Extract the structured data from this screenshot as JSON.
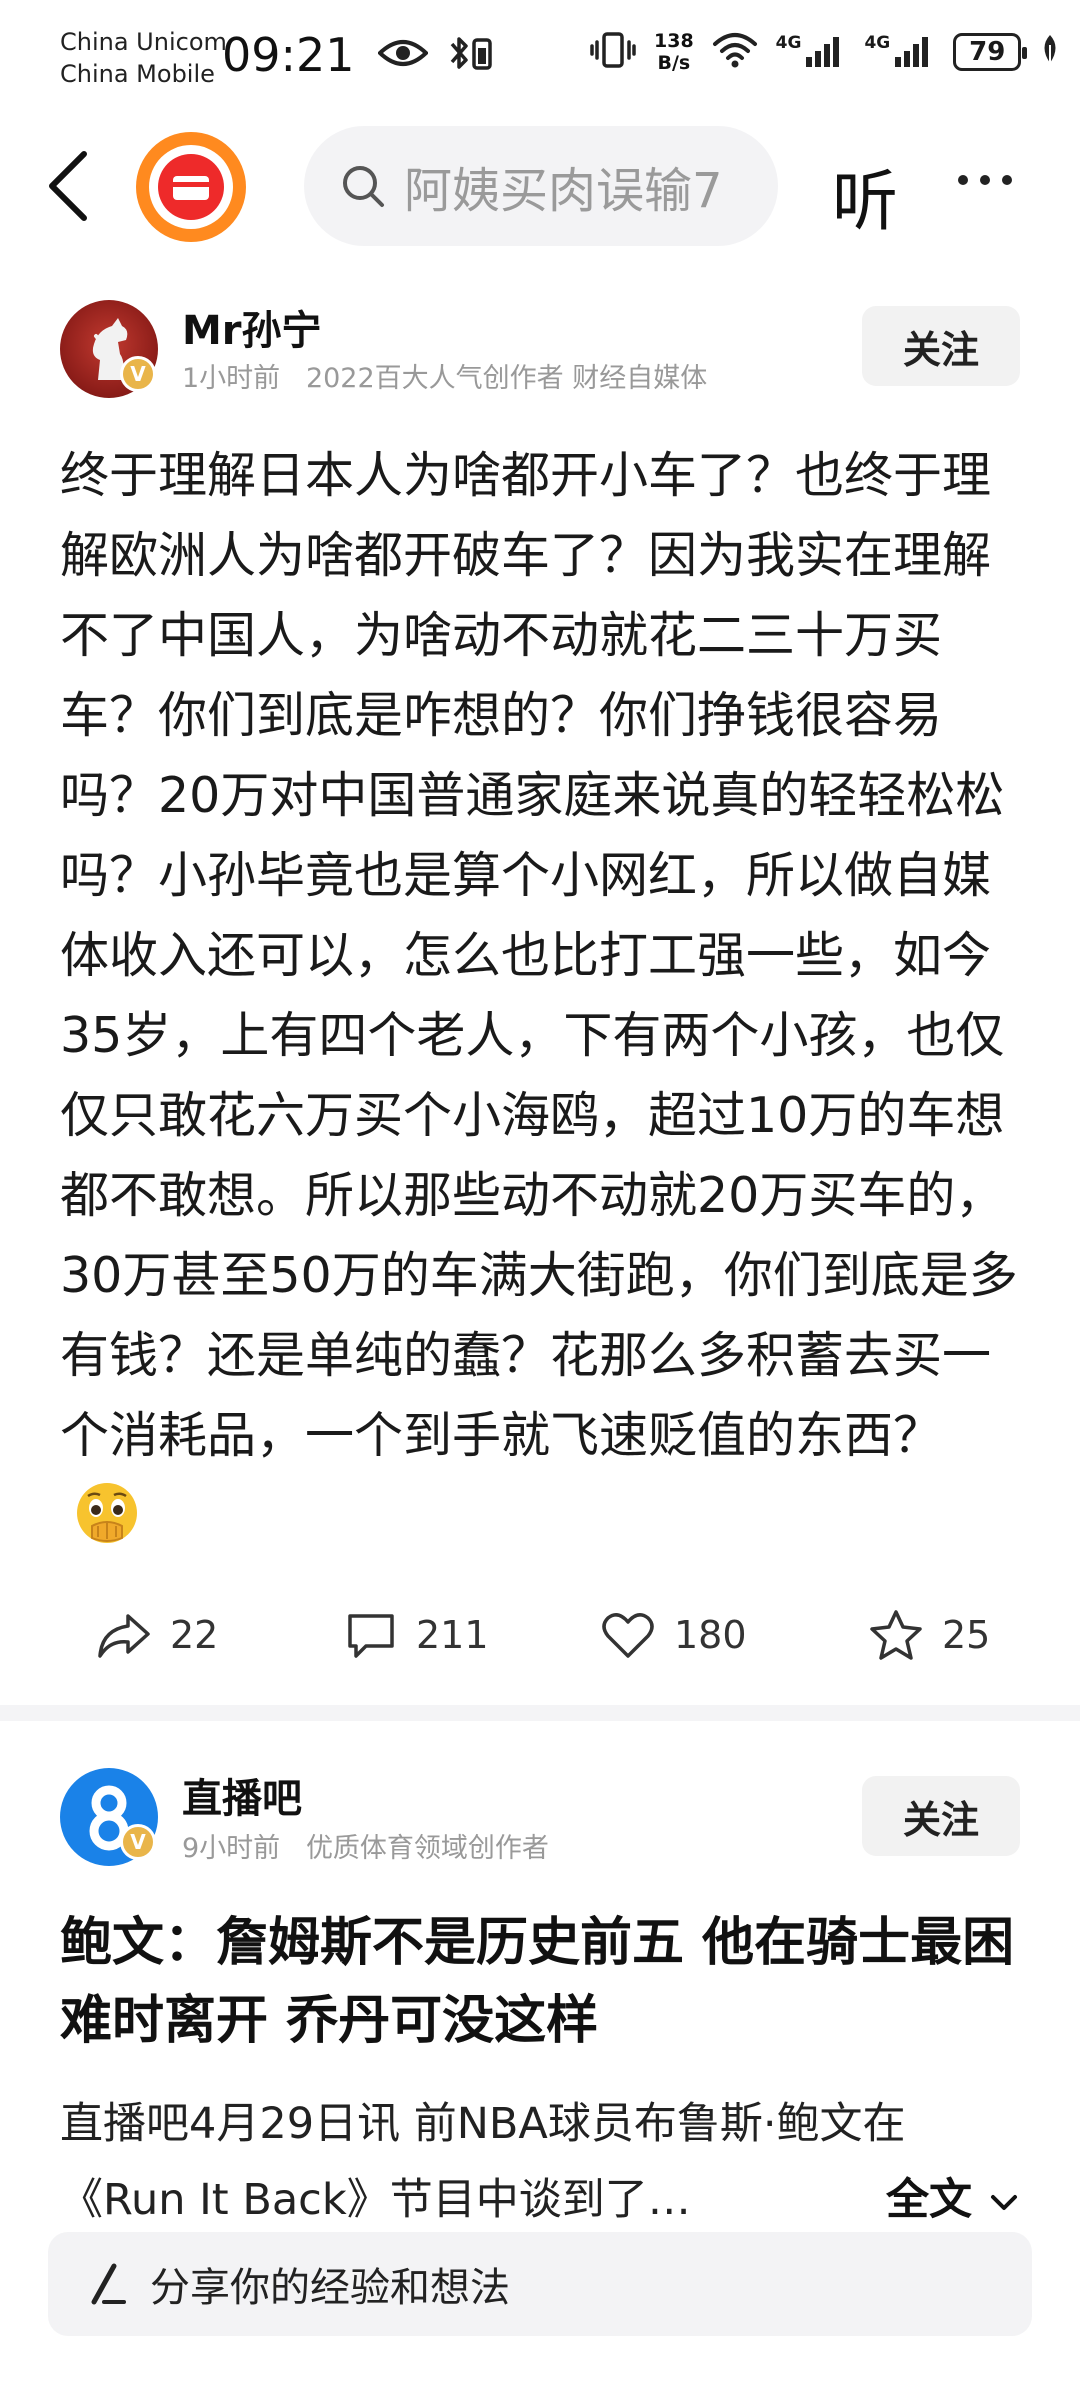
{
  "status_bar": {
    "carrier_1": "China Unicom",
    "carrier_2": "China Mobile",
    "time": "09:21",
    "net_speed_value": "138",
    "net_speed_unit": "B/s",
    "sig1_label": "4G",
    "sig2_label": "4G",
    "battery": "79"
  },
  "nav": {
    "search_placeholder": "阿姨买肉误输7",
    "listen_label": "听"
  },
  "post1": {
    "author": "Mr孙宁",
    "time": "1小时前",
    "meta": "2022百大人气创作者 财经自媒体",
    "follow_label": "关注",
    "body": "终于理解日本人为啥都开小车了？也终于理解欧洲人为啥都开破车了？因为我实在理解不了中国人，为啥动不动就花二三十万买车？你们到底是咋想的？你们挣钱很容易吗？20万对中国普通家庭来说真的轻轻松松吗？小孙毕竟也是算个小网红，所以做自媒体收入还可以，怎么也比打工强一些，如今35岁，上有四个老人，下有两个小孩，也仅仅只敢花六万买个小海鸥，超过10万的车想都不敢想。所以那些动不动就20万买车的，30万甚至50万的车满大街跑，你们到底是多有钱？还是单纯的蠢？花那么多积蓄去买一个消耗品，一个到手就飞速贬值的东西？",
    "shares": "22",
    "comments": "211",
    "likes": "180",
    "favorites": "25"
  },
  "post2": {
    "author": "直播吧",
    "time": "9小时前",
    "meta": "优质体育领域创作者",
    "follow_label": "关注",
    "title": "鲍文：詹姆斯不是历史前五 他在骑士最困难时离开 乔丹可没这样",
    "summary": "直播吧4月29日讯 前NBA球员布鲁斯·鲍文在《Run It Back》节目中谈到了…",
    "more_label": "全文"
  },
  "comment_bar": {
    "placeholder": "分享你的经验和想法"
  },
  "colors": {
    "accent_orange": "#ff8a1f",
    "logo_red": "#ee2a2a",
    "post2_avatar_blue": "#1a82e8",
    "verified_gold": "#e9b54a",
    "emoji_yellow": "#f7c32e"
  }
}
